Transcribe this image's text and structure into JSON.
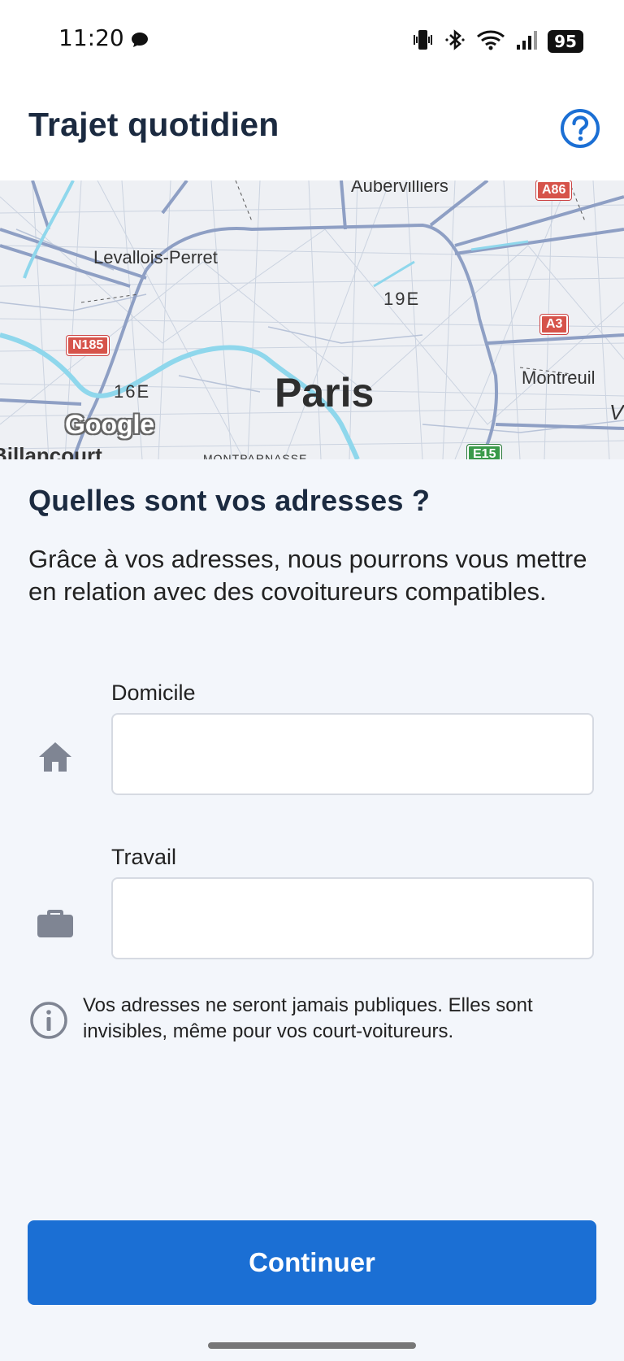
{
  "status_bar": {
    "time": "11:20",
    "battery": "95",
    "icons": [
      "chat-bubble-icon",
      "vibrate-icon",
      "bluetooth-icon",
      "wifi-icon",
      "signal-icon",
      "battery-icon"
    ]
  },
  "app_bar": {
    "title": "Trajet quotidien",
    "help_icon": "help-circle-icon"
  },
  "map": {
    "labels": {
      "aubervilliers": "Aubervilliers",
      "levallois": "Levallois-Perret",
      "arr19": "19E",
      "arr16": "16E",
      "paris": "Paris",
      "montreuil": "Montreuil",
      "v_fragment": "V",
      "billancourt": "Billancourt",
      "montparnasse": "MONTPARNASSE"
    },
    "badges": {
      "a86": "A86",
      "a3": "A3",
      "n185": "N185",
      "e15": "E15"
    },
    "attribution": "Google"
  },
  "content": {
    "title": "Quelles sont vos adresses ?",
    "description": "Grâce à vos adresses, nous pourrons vous mettre en relation avec des covoitureurs compatibles.",
    "home_field": {
      "label": "Domicile",
      "value": "",
      "icon": "home-icon"
    },
    "work_field": {
      "label": "Travail",
      "value": "",
      "icon": "briefcase-icon"
    },
    "privacy_note": "Vos adresses ne seront jamais publiques. Elles sont invisibles, même pour vos court-voitureurs.",
    "privacy_icon": "info-icon",
    "continue_label": "Continuer"
  },
  "colors": {
    "primary": "#1b6fd4",
    "title": "#1b2a40",
    "background": "#f3f6fb"
  }
}
